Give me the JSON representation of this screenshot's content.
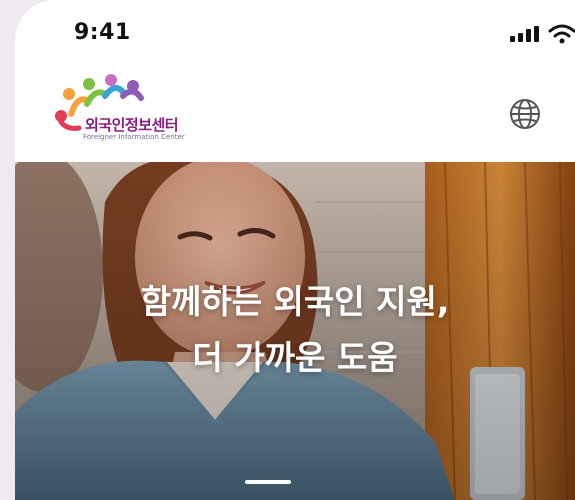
{
  "status_bar": {
    "time": "9:41",
    "signal_icon": "cellular-signal-icon",
    "wifi_icon": "wifi-icon"
  },
  "header": {
    "logo": {
      "title": "외국인정보센터",
      "subtitle": "Foreigner Information Center"
    },
    "language_icon": "globe-icon"
  },
  "hero": {
    "headline_line1": "함께하는 외국인 지원,",
    "headline_line2": "더 가까운 도움",
    "active_slide": 1
  },
  "colors": {
    "page_background": "#f1e9f1",
    "logo_text": "#8a1e7c",
    "headline_text": "#ffffff"
  }
}
